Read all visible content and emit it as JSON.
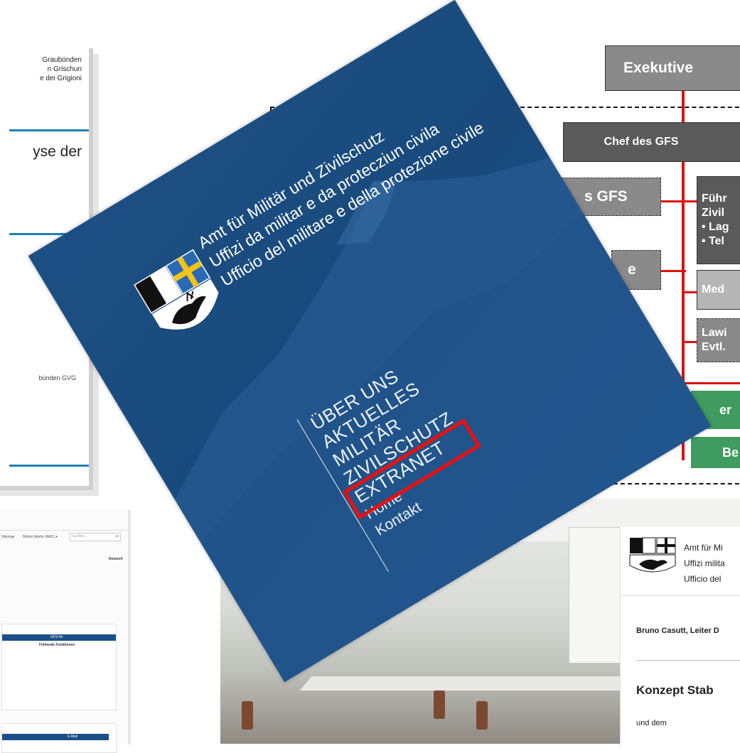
{
  "doc_a": {
    "header_lines": [
      "Graubünden",
      "n Grischun",
      "e dei Grigioni"
    ],
    "heading_fragment": "yse der",
    "footer_fragment": "bünden GVG"
  },
  "org_chart": {
    "exekutive": "Exekutive",
    "chef": "Chef des GFS",
    "gfs_fragment": "s GFS",
    "side_fragment": "e",
    "fuehr_box": [
      "Führ",
      "Zivil",
      "• Lag",
      "• Tel"
    ],
    "med": "Med",
    "lawi": [
      "Lawi",
      "Evtl."
    ],
    "green_top": "er",
    "green_bottom": "Be",
    "colors": {
      "red_line": "#e01010",
      "box_dark": "#5a5a5a",
      "box_mid": "#8a8a8a",
      "green": "#3f9b5f"
    }
  },
  "screenshot_b": {
    "nav": [
      "Sitemap",
      "Bühler Martin (AMZ) ▾"
    ],
    "search_placeholder": "Suchen...",
    "language": "Deutsch",
    "table1_header": "GFS-Nr.",
    "table1_sub": "Fehlende Funktionen",
    "table2_header": "E-Mail"
  },
  "card": {
    "agency_lines": [
      "Amt für Militär und Zivilschutz",
      "Uffizi da militar e da protecziun civila",
      "Ufficio del militare e della protezione civile"
    ],
    "menu": [
      "ÜBER UNS",
      "AKTUELLES",
      "MILITÄR",
      "ZIVILSCHUTZ",
      "EXTRANET"
    ],
    "submenu": [
      "Home",
      "Kontakt"
    ],
    "highlighted": "EXTRANET",
    "highlight_color": "#ea1010"
  },
  "letter": {
    "org_lines": [
      "Amt für Mi",
      "Uffizi milita",
      "Ufficio del"
    ],
    "author": "Bruno Casutt, Leiter D",
    "title": "Konzept Stab",
    "body": "und dem"
  }
}
